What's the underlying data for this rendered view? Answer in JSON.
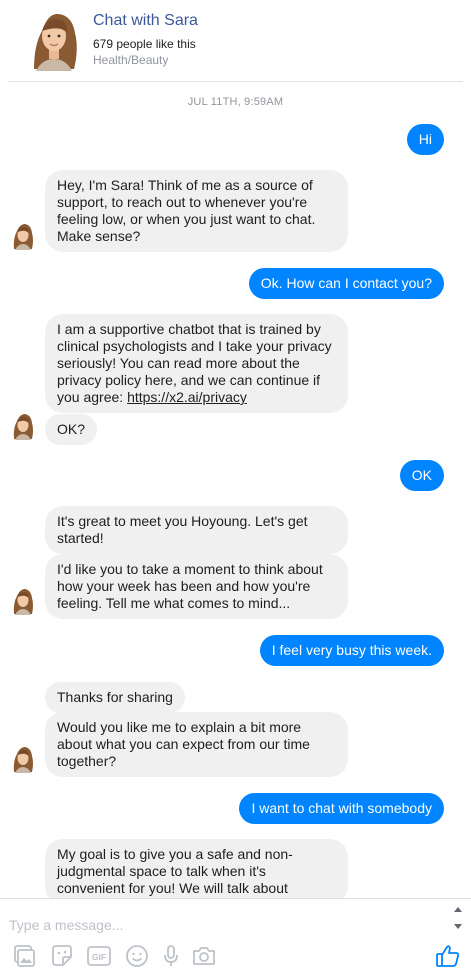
{
  "header": {
    "title": "Chat with Sara",
    "likes": "679 people like this",
    "category": "Health/Beauty",
    "avatar_icon": "sara-avatar"
  },
  "thread": {
    "timestamp": "JUL 11TH, 9:59AM",
    "messages": [
      {
        "from": "user",
        "text": "Hi"
      },
      {
        "from": "bot",
        "text": "Hey, I'm Sara! Think of me as a source of support, to reach out to whenever you're feeling low, or when you just want to chat. Make sense?"
      },
      {
        "from": "user",
        "text": "Ok. How can I contact you?"
      },
      {
        "from": "bot",
        "text": "I am a supportive chatbot that is trained by clinical psychologists and I take your privacy seriously! You can read more about the privacy policy here, and we can continue if you agree:",
        "link": "https://x2.ai/privacy"
      },
      {
        "from": "bot",
        "text": "OK?"
      },
      {
        "from": "user",
        "text": "OK"
      },
      {
        "from": "bot",
        "text": "It's great to meet you Hoyoung. Let's get started!"
      },
      {
        "from": "bot",
        "text": "I'd like you to take a moment to think about how your week has been and how you're feeling. Tell me what comes to mind..."
      },
      {
        "from": "user",
        "text": "I feel very busy this week."
      },
      {
        "from": "bot",
        "text": "Thanks for sharing"
      },
      {
        "from": "bot",
        "text": "Would you like me to explain a bit more about what you can expect from our time together?"
      },
      {
        "from": "user",
        "text": "I want to chat with somebody"
      },
      {
        "from": "bot",
        "text": "My goal is to give you a safe and non-judgmental space to talk when it's convenient for you! We will talk about"
      }
    ]
  },
  "composer": {
    "placeholder": "Type a message...",
    "tools": [
      "image-icon",
      "sticker-icon",
      "gif-icon",
      "emoji-icon",
      "microphone-icon",
      "camera-icon"
    ],
    "like_icon": "thumbs-up-icon"
  },
  "colors": {
    "user_bubble": "#0084ff",
    "bot_bubble": "#f1f0f0",
    "title": "#3b5998"
  }
}
